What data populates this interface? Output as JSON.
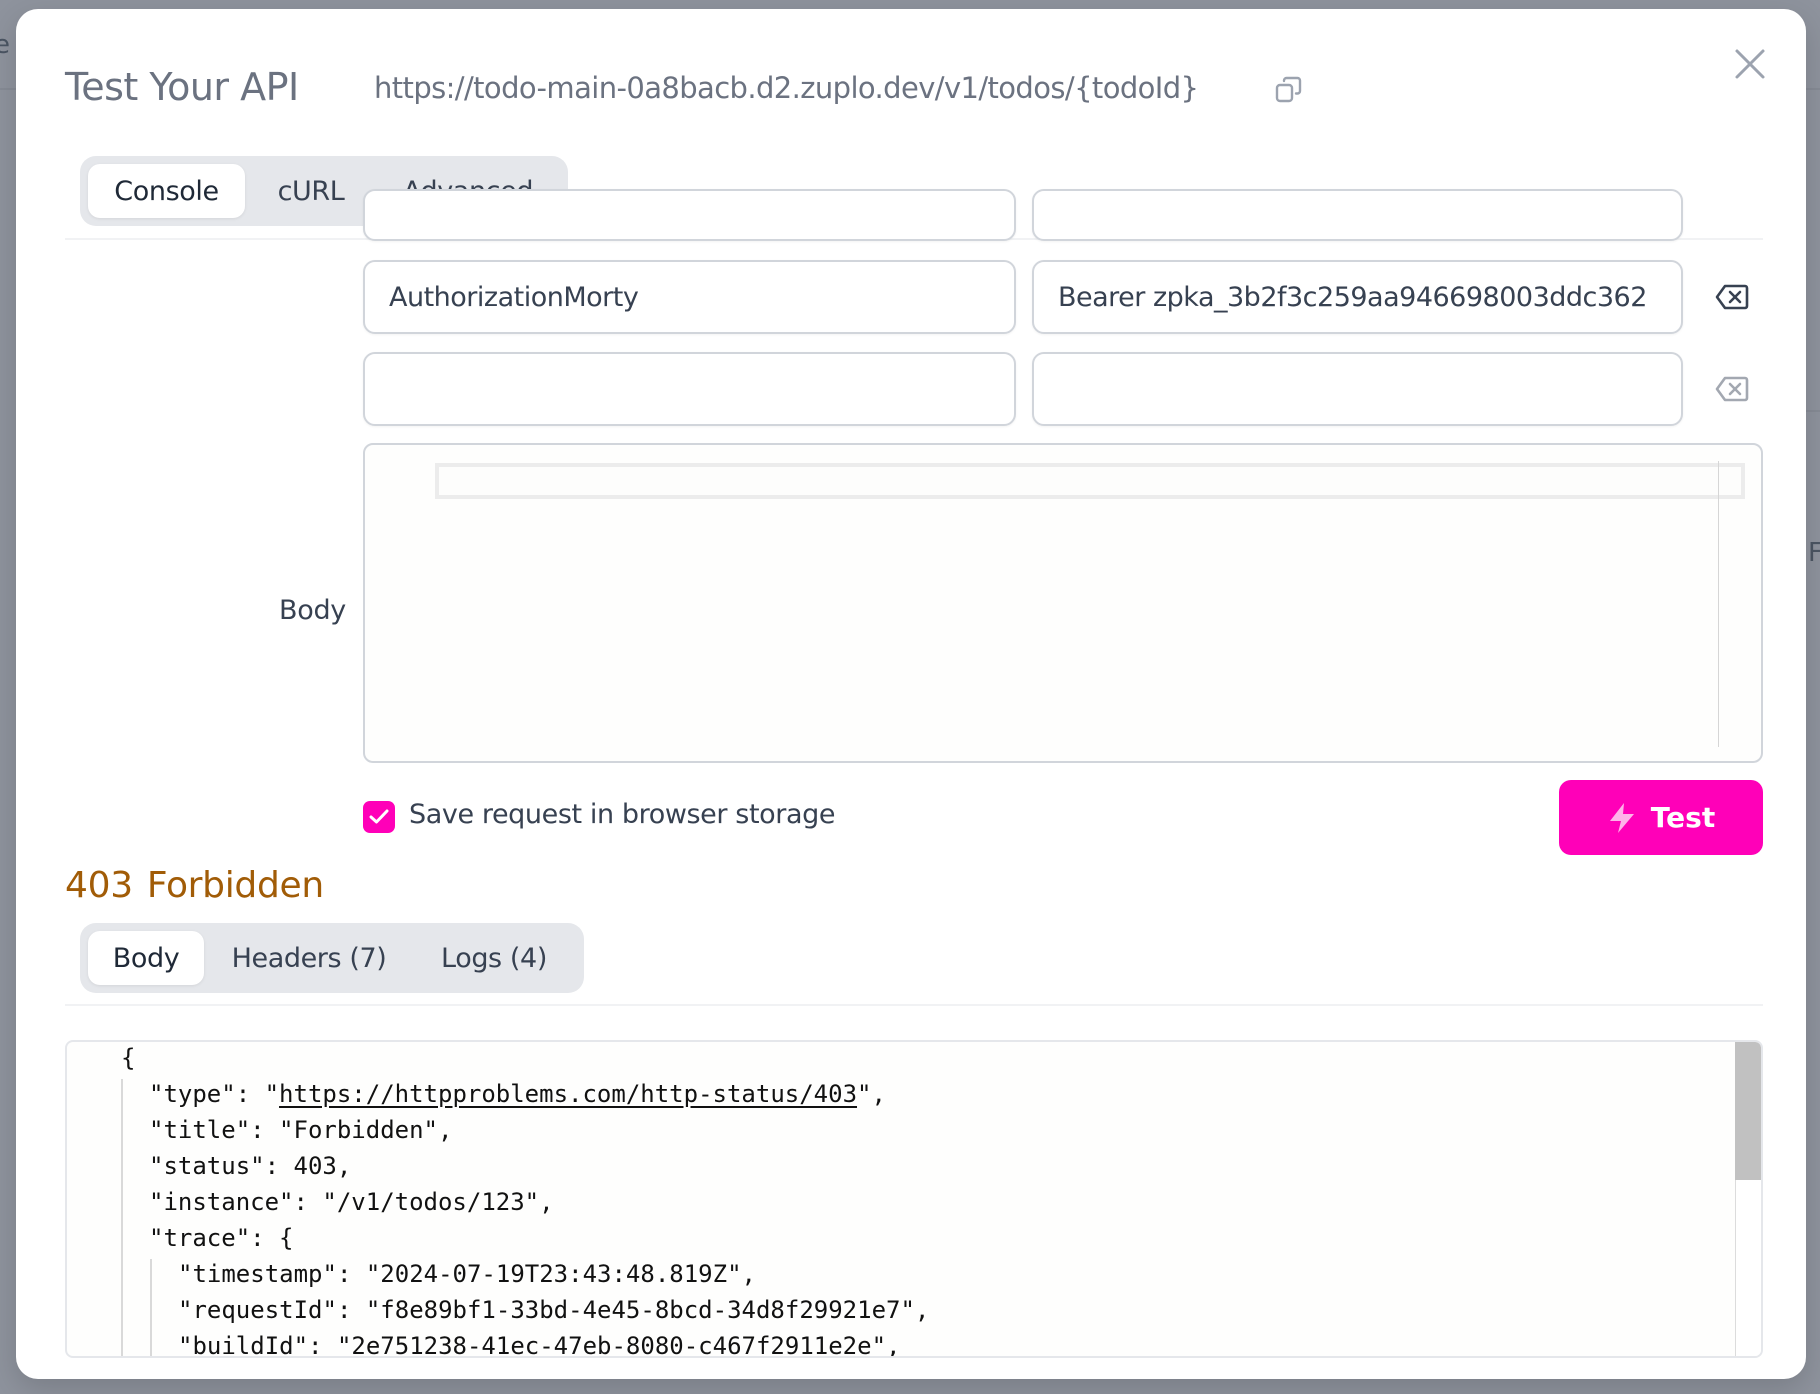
{
  "dialog": {
    "title": "Test Your API",
    "url": "https://todo-main-0a8bacb.d2.zuplo.dev/v1/todos/{todoId}",
    "copy_icon": "copy-icon",
    "close_icon": "close-icon"
  },
  "request_tabs": [
    {
      "label": "Console",
      "active": true
    },
    {
      "label": "cURL",
      "active": false
    },
    {
      "label": "Advanced",
      "active": false
    }
  ],
  "headers": [
    {
      "name": "AuthorizationMorty",
      "value": "Bearer zpka_3b2f3c259aa946698003ddc362",
      "delete_enabled": true
    },
    {
      "name": "",
      "value": "",
      "delete_enabled": false
    }
  ],
  "body": {
    "label": "Body",
    "content": ""
  },
  "save_request": {
    "label": "Save request in browser storage",
    "checked": true
  },
  "test_button": {
    "label": "Test",
    "icon": "lightning-icon"
  },
  "response": {
    "status_code": "403",
    "status_text": "Forbidden",
    "status_color": "#a15c07",
    "tabs": [
      {
        "label": "Body",
        "active": true
      },
      {
        "label": "Headers (7)",
        "active": false
      },
      {
        "label": "Logs (4)",
        "active": false
      }
    ],
    "body_lines": [
      {
        "indent": 0,
        "text": "{"
      },
      {
        "indent": 1,
        "key": "\"type\": \"",
        "link": "https://httpproblems.com/http-status/403",
        "after": "\","
      },
      {
        "indent": 1,
        "text": "\"title\": \"Forbidden\","
      },
      {
        "indent": 1,
        "text": "\"status\": 403,"
      },
      {
        "indent": 1,
        "text": "\"instance\": \"/v1/todos/123\","
      },
      {
        "indent": 1,
        "text": "\"trace\": {"
      },
      {
        "indent": 2,
        "text": "\"timestamp\": \"2024-07-19T23:43:48.819Z\","
      },
      {
        "indent": 2,
        "text": "\"requestId\": \"f8e89bf1-33bd-4e45-8bcd-34d8f29921e7\","
      },
      {
        "indent": 2,
        "text": "\"buildId\": \"2e751238-41ec-47eb-8080-c467f2911e2e\","
      }
    ]
  },
  "colors": {
    "accent": "#ff00b8",
    "overlay": "#8e939d"
  }
}
